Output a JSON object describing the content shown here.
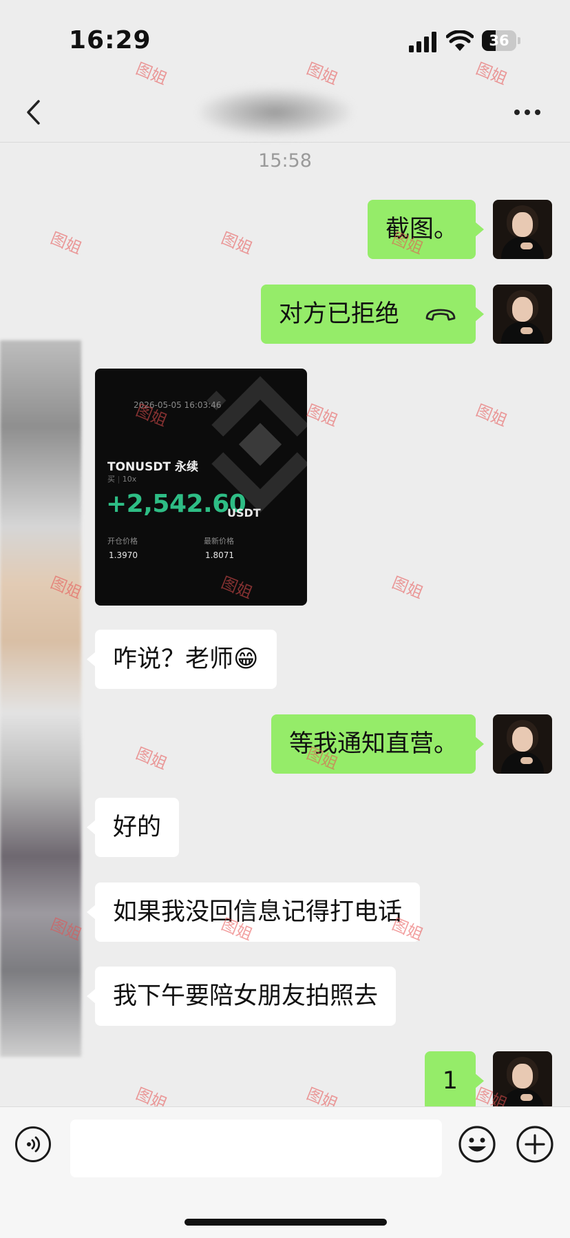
{
  "status_bar": {
    "time": "16:29",
    "battery": "36"
  },
  "header": {
    "title": ""
  },
  "chat": {
    "timestamp": "15:58",
    "messages": {
      "m1": {
        "text": "截图。"
      },
      "m2": {
        "text": "对方已拒绝",
        "icon": "hangup-icon"
      },
      "m4": {
        "text": "咋说？老师😁"
      },
      "m5": {
        "text": "等我通知直营。"
      },
      "m6": {
        "text": "好的"
      },
      "m7": {
        "text": "如果我没回信息记得打电话"
      },
      "m8": {
        "text": "我下午要陪女朋友拍照去"
      },
      "m9": {
        "text": "1"
      }
    }
  },
  "trade_card": {
    "datetime": "2026-05-05 16:03:46",
    "symbol": "TONUSDT 永续",
    "side": "买",
    "leverage": "10x",
    "pnl": "+2,542.60",
    "unit": "USDT",
    "entry_label": "开仓价格",
    "entry_price": "1.3970",
    "last_label": "最新价格",
    "last_price": "1.8071"
  },
  "watermark": "图姐",
  "input_bar": {
    "value": "",
    "placeholder": ""
  },
  "colors": {
    "sent_bubble": "#95ec69",
    "received_bubble": "#ffffff",
    "background": "#ededed",
    "pnl_green": "#2ebd85"
  }
}
